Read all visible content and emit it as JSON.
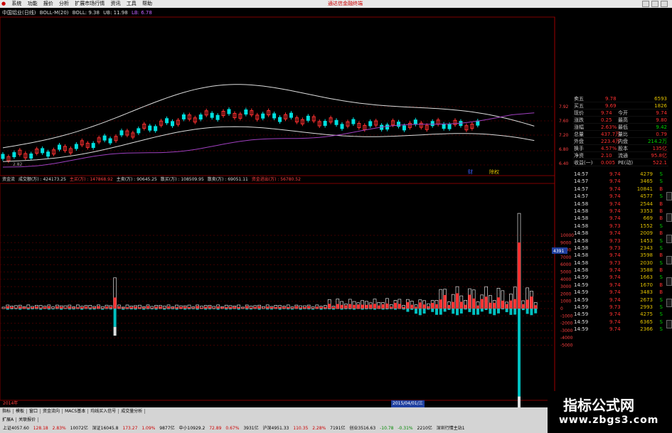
{
  "menu": {
    "logo": "●",
    "items": [
      "系统",
      "功能",
      "报价",
      "分析",
      "扩展市场行情",
      "资讯",
      "工具",
      "帮助"
    ],
    "broker": "通达信金融终端"
  },
  "chart_title": {
    "stock": "中国铝业(日线)",
    "indicator": "BOLL-M(20)",
    "boll_label": "BOLL: 9.38",
    "ub_label": "UB: 11.98",
    "lb_label": "LB: 6.78"
  },
  "price_axis": {
    "labels": [
      "7.92",
      "7.60",
      "7.20",
      "6.80",
      "6.40"
    ],
    "low_label": "2.82"
  },
  "sub_chart": {
    "name": "资金流",
    "vol_label": "成交额(万) : 424173.25",
    "main_in": "主买(万) : 147868.92",
    "main_sale": "主卖(万) : 90645.25",
    "retail_in": "散买(万) : 108509.95",
    "retail_sale": "散卖(万) : 69051.11",
    "net": "资金进出(万) : 56780.52",
    "axis": [
      "10000",
      "9000",
      "8000",
      "7000",
      "6000",
      "5000",
      "4000",
      "3000",
      "2000",
      "1000",
      "0",
      "-1000",
      "-2000",
      "-3000",
      "-4000",
      "-5000"
    ],
    "cursor": "4391"
  },
  "annotations": {
    "a1": "财",
    "a2": "除",
    "a3": "权"
  },
  "x_axis": {
    "start": "2014年",
    "mid": "2015/04/01/三"
  },
  "quote": {
    "sell5": {
      "label": "卖五",
      "price": "9.78",
      "vol": "6593"
    },
    "buy5": {
      "label": "买五",
      "price": "9.69",
      "vol": "1826"
    },
    "rows": [
      {
        "l": "现价",
        "v": "9.74",
        "l2": "今开",
        "v2": "9.74"
      },
      {
        "l": "涨跌",
        "v": "0.25",
        "l2": "最高",
        "v2": "9.80"
      },
      {
        "l": "涨幅",
        "v": "2.63%",
        "l2": "最低",
        "v2": "9.42"
      },
      {
        "l": "总量",
        "v": "437.7万",
        "l2": "量比",
        "v2": "0.79"
      },
      {
        "l": "外盘",
        "v": "223.4万",
        "l2": "内盘",
        "v2": "214.2万"
      },
      {
        "l": "换手",
        "v": "4.57%",
        "l2": "股本",
        "v2": "135亿"
      },
      {
        "l": "净资",
        "v": "2.10",
        "l2": "流通",
        "v2": "95.8亿"
      },
      {
        "l": "收益(一)",
        "v": "0.005",
        "l2": "PE(动)",
        "v2": "522.1"
      }
    ]
  },
  "ticks": [
    {
      "t": "14:57",
      "p": "9.74",
      "v": "4279",
      "s": "S"
    },
    {
      "t": "14:57",
      "p": "9.74",
      "v": "3465",
      "s": "S"
    },
    {
      "t": "14:57",
      "p": "9.74",
      "v": "10841",
      "s": "B"
    },
    {
      "t": "14:57",
      "p": "9.74",
      "v": "4577",
      "s": "S"
    },
    {
      "t": "14:58",
      "p": "9.74",
      "v": "2544",
      "s": "B"
    },
    {
      "t": "14:58",
      "p": "9.74",
      "v": "3353",
      "s": "B"
    },
    {
      "t": "14:58",
      "p": "9.74",
      "v": "669",
      "s": "B"
    },
    {
      "t": "14:58",
      "p": "9.73",
      "v": "1552",
      "s": "S"
    },
    {
      "t": "14:58",
      "p": "9.74",
      "v": "2009",
      "s": "B"
    },
    {
      "t": "14:58",
      "p": "9.73",
      "v": "1453",
      "s": "S"
    },
    {
      "t": "14:58",
      "p": "9.73",
      "v": "2343",
      "s": "S"
    },
    {
      "t": "14:58",
      "p": "9.74",
      "v": "3598",
      "s": "B"
    },
    {
      "t": "14:58",
      "p": "9.73",
      "v": "2030",
      "s": "S"
    },
    {
      "t": "14:58",
      "p": "9.74",
      "v": "3588",
      "s": "B"
    },
    {
      "t": "14:59",
      "p": "9.74",
      "v": "1663",
      "s": "S"
    },
    {
      "t": "14:59",
      "p": "9.74",
      "v": "1670",
      "s": "B"
    },
    {
      "t": "14:59",
      "p": "9.74",
      "v": "3483",
      "s": "B"
    },
    {
      "t": "14:59",
      "p": "9.74",
      "v": "2673",
      "s": "S"
    },
    {
      "t": "14:59",
      "p": "9.73",
      "v": "2993",
      "s": "S"
    },
    {
      "t": "14:59",
      "p": "9.74",
      "v": "4275",
      "s": "S"
    },
    {
      "t": "14:59",
      "p": "9.74",
      "v": "6365",
      "s": "S"
    },
    {
      "t": "14:59",
      "p": "9.74",
      "v": "2366",
      "s": "S"
    }
  ],
  "tabs": [
    "指标",
    "模板",
    "窗口",
    "资金流向",
    "MACS基本",
    "均线买入信号",
    "成交量分析"
  ],
  "tabs2": [
    "扩展A",
    "关联报价"
  ],
  "status": {
    "sh": "上证4057.60",
    "sh_chg": "128.18",
    "sh_pct": "2.83%",
    "sh_amt": "10072亿",
    "sz": "深证16045.8",
    "sz_chg": "173.27",
    "sz_pct": "1.09%",
    "sz_amt": "9877亿",
    "zx": "中小10929.2",
    "zx_chg": "72.89",
    "zx_pct": "0.67%",
    "zx_amt": "3931亿",
    "hs": "沪深4951.33",
    "hs_chg": "110.35",
    "hs_pct": "2.28%",
    "hs_amt": "7191亿",
    "cy": "创业3516.63",
    "cy_chg": "-10.78",
    "cy_pct": "-0.31%",
    "cy_amt": "2210亿",
    "right": "深圳行情主站1"
  },
  "watermark": {
    "line1": "指标公式网",
    "line2": "www.zbgs3.com"
  },
  "colors": {
    "up": "#ff3030",
    "down": "#00e0e0",
    "purple": "#a040c0",
    "gold": "#e0c000"
  }
}
